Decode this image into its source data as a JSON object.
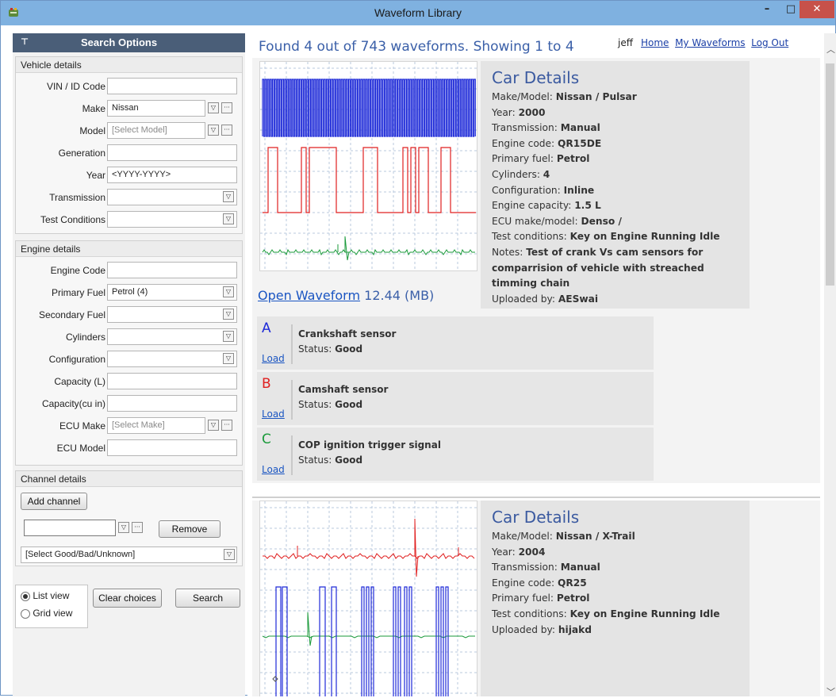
{
  "window": {
    "title": "Waveform Library",
    "minimize": "–",
    "maximize": "□",
    "close": "✕"
  },
  "sidebar": {
    "header": "Search Options",
    "pin_icon": "⊤",
    "vehicle_group": "Vehicle details",
    "vehicle_fields": [
      {
        "label": "VIN / ID Code",
        "value": ""
      },
      {
        "label": "Make",
        "value": "Nissan"
      },
      {
        "label": "Model",
        "value": "[Select Model]"
      },
      {
        "label": "Generation",
        "value": ""
      },
      {
        "label": "Year",
        "value": "<YYYY-YYYY>"
      },
      {
        "label": "Transmission",
        "value": ""
      },
      {
        "label": "Test Conditions",
        "value": ""
      }
    ],
    "engine_group": "Engine details",
    "engine_fields": [
      {
        "label": "Engine Code",
        "value": ""
      },
      {
        "label": "Primary Fuel",
        "value": "Petrol (4)"
      },
      {
        "label": "Secondary Fuel",
        "value": ""
      },
      {
        "label": "Cylinders",
        "value": ""
      },
      {
        "label": "Configuration",
        "value": ""
      },
      {
        "label": "Capacity (L)",
        "value": ""
      },
      {
        "label": "Capacity(cu in)",
        "value": ""
      },
      {
        "label": "ECU Make",
        "value": "[Select Make]"
      },
      {
        "label": "ECU Model",
        "value": ""
      }
    ],
    "channel_group": "Channel details",
    "add_channel": "Add channel",
    "channel_value": "",
    "remove": "Remove",
    "quality_select": "[Select Good/Bad/Unknown]",
    "list_view": "List view",
    "grid_view": "Grid view",
    "clear_choices": "Clear choices",
    "search": "Search"
  },
  "main": {
    "found_text": "Found 4 out of 743 waveforms. Showing 1 to 4",
    "user": "jeff",
    "nav": [
      "Home",
      "My Waveforms",
      "Log Out"
    ],
    "results": [
      {
        "heading": "Car Details",
        "fields": [
          {
            "label": "Make/Model: ",
            "value": "Nissan / Pulsar"
          },
          {
            "label": "Year: ",
            "value": "2000"
          },
          {
            "label": "Transmission: ",
            "value": "Manual"
          },
          {
            "label": "Engine code: ",
            "value": "QR15DE"
          },
          {
            "label": "Primary fuel: ",
            "value": "Petrol"
          },
          {
            "label": "Cylinders: ",
            "value": "4"
          },
          {
            "label": "Configuration: ",
            "value": "Inline"
          },
          {
            "label": "Engine capacity: ",
            "value": "1.5 L"
          },
          {
            "label": "ECU make/model: ",
            "value": "Denso /"
          },
          {
            "label": "Test conditions: ",
            "value": "Key on Engine Running Idle"
          },
          {
            "label": "Notes: ",
            "value": "Test of crank Vs cam sensors for comparrision of vehicle with streached timming chain"
          },
          {
            "label": "Uploaded by: ",
            "value": "AESwai"
          }
        ],
        "open_link": "Open Waveform",
        "size": "12.44 (MB)",
        "channels": [
          {
            "letter": "A",
            "color": "#1e2ad8",
            "name": "Crankshaft sensor",
            "status_label": "Status: ",
            "status": "Good",
            "load": "Load"
          },
          {
            "letter": "B",
            "color": "#e02020",
            "name": "Camshaft sensor",
            "status_label": "Status: ",
            "status": "Good",
            "load": "Load"
          },
          {
            "letter": "C",
            "color": "#1a9a3a",
            "name": "COP ignition trigger signal",
            "status_label": "Status: ",
            "status": "Good",
            "load": "Load"
          }
        ]
      },
      {
        "heading": "Car Details",
        "fields": [
          {
            "label": "Make/Model: ",
            "value": "Nissan / X-Trail"
          },
          {
            "label": "Year: ",
            "value": "2004"
          },
          {
            "label": "Transmission: ",
            "value": "Manual"
          },
          {
            "label": "Engine code: ",
            "value": "QR25"
          },
          {
            "label": "Primary fuel: ",
            "value": "Petrol"
          },
          {
            "label": "Test conditions: ",
            "value": "Key on Engine Running Idle"
          },
          {
            "label": "Uploaded by: ",
            "value": "hijakd"
          }
        ]
      }
    ]
  },
  "colors": {
    "sidebar_header": "#4a5e78",
    "title_bar": "#7fb1e0",
    "link": "#1a55c2",
    "heading": "#3b5aa0"
  }
}
